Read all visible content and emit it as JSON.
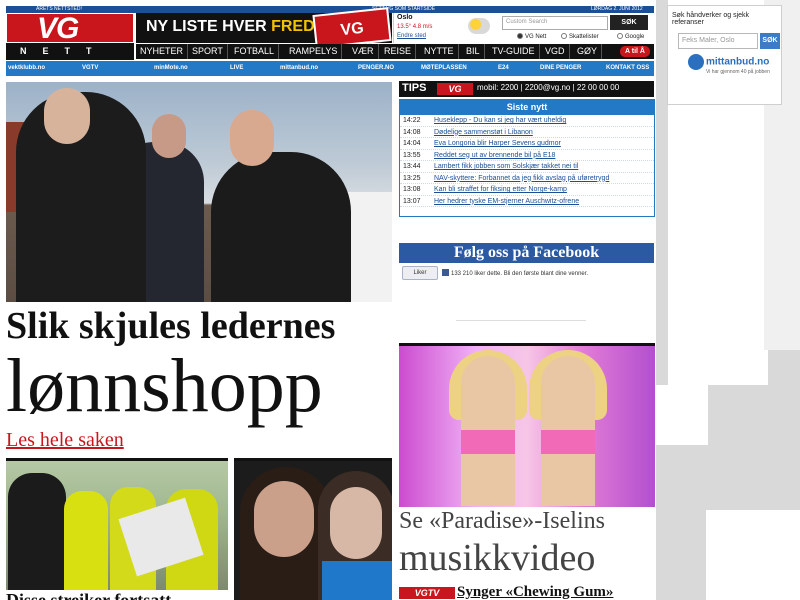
{
  "header": {
    "topbar_left": "ÅRETS NETTSTED!",
    "topbar_center": "SETT VG SOM STARTSIDE",
    "topbar_date": "LØRDAG 2. JUNI 2012",
    "logo_text": "VG",
    "logo_sub": "NETT",
    "banner_text_a": "NY LISTE HVER",
    "banner_text_b": "FREDAG",
    "banner_badge": "VG LISTA",
    "weather": {
      "city": "Oslo",
      "temp": "13.5° 4.8 m/s",
      "link": "Endre sted"
    },
    "search": {
      "placeholder": "Custom Search",
      "button": "SØK",
      "options": [
        "VG Nett",
        "Skattelister",
        "Google"
      ],
      "selected": "VG Nett"
    }
  },
  "nav": {
    "items": [
      "NYHETER",
      "SPORT",
      "FOTBALL",
      "RAMPELYS",
      "VÆR",
      "REISE",
      "NYTTE",
      "BIL",
      "TV-GUIDE",
      "VGD",
      "GØY"
    ],
    "abc_label": "A til Å"
  },
  "partners": [
    "vektklubb.no",
    "VGTV",
    "minMote.no",
    "LIVE",
    "mittanbud.no",
    "PENGER.NO",
    "MØTEPLASSEN",
    "E24",
    "DINE PENGER",
    "KONTAKT OSS"
  ],
  "side_ad": {
    "text": "Søk håndverker og sjekk referanser",
    "placeholder": "Feks Maler, Oslo",
    "button": "SØK",
    "brand": "mittanbud.no",
    "sub": "Vi har gjennom 40 på jobben"
  },
  "main": {
    "headline_line1": "Slik skjules ledernes",
    "headline_line2": "lønnshopp",
    "read_more": "Les hele saken",
    "bottom_headline": "Disse streiker fortsatt"
  },
  "tips": {
    "label": "TIPS",
    "brand": "VG",
    "info": "mobil: 2200 | 2200@vg.no | 22 00 00 00"
  },
  "latest": {
    "title": "Siste nytt",
    "items": [
      {
        "time": "14:22",
        "text": "Huseklepp - Du kan si jeg har vært uheldig"
      },
      {
        "time": "14:08",
        "text": "Dødelige sammenstøt i Libanon"
      },
      {
        "time": "14:04",
        "text": "Eva Longoria blir Harper Sevens gudmor"
      },
      {
        "time": "13:55",
        "text": "Reddet seg ut av brennende bil på E18"
      },
      {
        "time": "13:44",
        "text": "Lambert fikk jobben som Solskjær takket nei til"
      },
      {
        "time": "13:25",
        "text": "NAV-skyttere: Forbannet da jeg fikk avslag på uføretrygd"
      },
      {
        "time": "13:08",
        "text": "Kan bli straffet for fiksing etter Norge-kamp"
      },
      {
        "time": "13:07",
        "text": "Her hedrer tyske EM-stjerner Auschwitz-ofrene"
      }
    ]
  },
  "facebook": {
    "title": "Følg oss på Facebook",
    "like_button": "Liker",
    "like_text": "133 210 liker dette. Bli den første blant dine venner."
  },
  "video": {
    "title_line1": "Se «Paradise»-Iselins",
    "title_line2": "musikkvideo",
    "badge": "VGTV",
    "caption": "Synger «Chewing Gum»"
  }
}
